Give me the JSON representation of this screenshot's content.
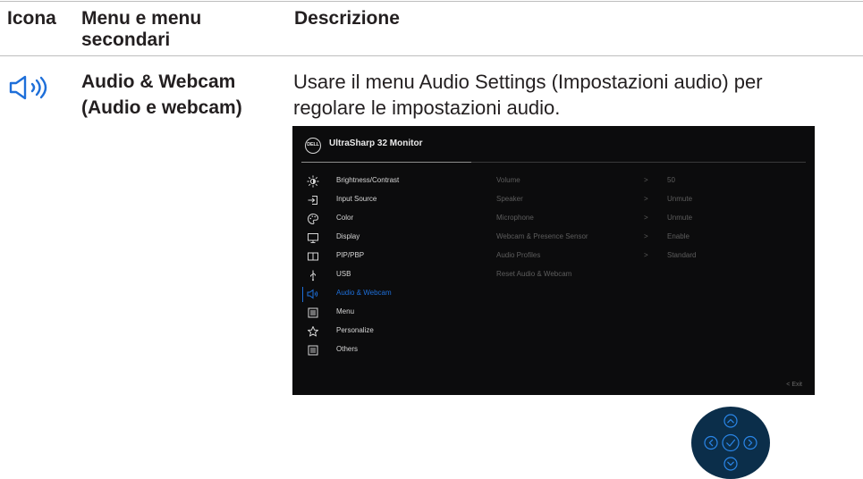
{
  "table": {
    "headers": {
      "icon": "Icona",
      "menu": "Menu e menu secondari",
      "description": "Descrizione"
    },
    "row": {
      "icon": "speaker-icon",
      "title": "Audio & Webcam (Audio e webcam)",
      "description": "Usare il menu Audio Settings (Impostazioni audio) per regolare le impostazioni audio."
    }
  },
  "osd": {
    "logo": "DELL",
    "title": "UltraSharp 32 Monitor",
    "menu_items": [
      {
        "label": "Brightness/Contrast",
        "icon": "brightness-icon"
      },
      {
        "label": "Input Source",
        "icon": "input-source-icon"
      },
      {
        "label": "Color",
        "icon": "color-icon"
      },
      {
        "label": "Display",
        "icon": "display-icon"
      },
      {
        "label": "PIP/PBP",
        "icon": "pip-pbp-icon"
      },
      {
        "label": "USB",
        "icon": "usb-icon"
      },
      {
        "label": "Audio & Webcam",
        "icon": "speaker-icon",
        "active": true
      },
      {
        "label": "Menu",
        "icon": "menu-icon"
      },
      {
        "label": "Personalize",
        "icon": "star-icon"
      },
      {
        "label": "Others",
        "icon": "others-icon"
      }
    ],
    "submenu": [
      {
        "label": "Volume",
        "value": "50"
      },
      {
        "label": "Speaker",
        "value": "Unmute"
      },
      {
        "label": "Microphone",
        "value": "Unmute"
      },
      {
        "label": "Webcam & Presence Sensor",
        "value": "Enable"
      },
      {
        "label": "Audio Profiles",
        "value": "Standard"
      },
      {
        "label": "Reset Audio & Webcam",
        "value": ""
      }
    ],
    "arrow": ">",
    "exit": "< Exit"
  },
  "colors": {
    "accent": "#1e6fd9",
    "osd_background": "#0c0c0d",
    "joystick": "#0b2e4a"
  }
}
